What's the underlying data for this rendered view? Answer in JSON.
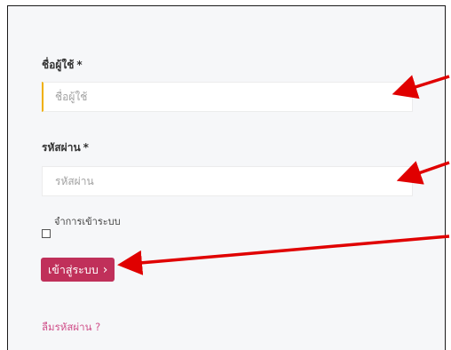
{
  "form": {
    "username_label": "ชื่อผู้ใช้",
    "username_required": "*",
    "username_placeholder": "ชื่อผู้ใช้",
    "password_label": "รหัสผ่าน",
    "password_required": "*",
    "password_placeholder": "รหัสผ่าน",
    "remember_label": "จำการเข้าระบบ",
    "login_button": "เข้าสู่ระบบ",
    "login_chevron": "›",
    "forgot_link": "ลืมรหัสผ่าน ?"
  },
  "colors": {
    "button_bg": "#c0305a",
    "link": "#d0508a",
    "arrow": "#e00000",
    "panel_bg": "#f6f7f9"
  },
  "icons": {
    "chevron": "chevron-right-icon",
    "annotation": "red-arrow-icon"
  }
}
